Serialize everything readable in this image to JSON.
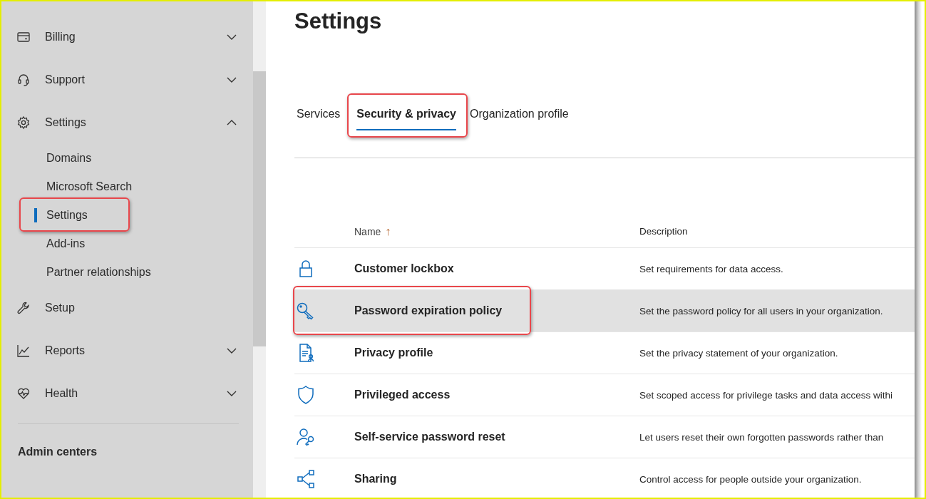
{
  "sidebar": {
    "items": [
      {
        "label": "Billing",
        "expanded": false
      },
      {
        "label": "Support",
        "expanded": false
      },
      {
        "label": "Settings",
        "expanded": true,
        "children": [
          {
            "label": "Domains",
            "selected": false,
            "annotated": false
          },
          {
            "label": "Microsoft Search",
            "selected": false,
            "annotated": false
          },
          {
            "label": "Settings",
            "selected": true,
            "annotated": true
          },
          {
            "label": "Add-ins",
            "selected": false,
            "annotated": false
          },
          {
            "label": "Partner relationships",
            "selected": false,
            "annotated": false
          }
        ]
      },
      {
        "label": "Setup"
      },
      {
        "label": "Reports",
        "expanded": false
      },
      {
        "label": "Health",
        "expanded": false
      }
    ],
    "section_heading": "Admin centers"
  },
  "page": {
    "title": "Settings",
    "tabs": [
      {
        "label": "Services",
        "selected": false,
        "annotated": false
      },
      {
        "label": "Security & privacy",
        "selected": true,
        "annotated": true
      },
      {
        "label": "Organization profile",
        "selected": false,
        "annotated": false
      }
    ],
    "table": {
      "columns": [
        {
          "label": "Name",
          "sort_arrow": "↑"
        },
        {
          "label": "Description"
        }
      ],
      "rows": [
        {
          "name": "Customer lockbox",
          "description": "Set requirements for data access.",
          "selected": false,
          "annotated": false
        },
        {
          "name": "Password expiration policy",
          "description": "Set the password policy for all users in your organization.",
          "selected": true,
          "annotated": true
        },
        {
          "name": "Privacy profile",
          "description": "Set the privacy statement of your organization.",
          "selected": false,
          "annotated": false
        },
        {
          "name": "Privileged access",
          "description": "Set scoped access for privilege tasks and data access withi",
          "selected": false,
          "annotated": false
        },
        {
          "name": "Self-service password reset",
          "description": "Let users reset their own forgotten passwords rather than",
          "selected": false,
          "annotated": false
        },
        {
          "name": "Sharing",
          "description": "Control access for people outside your organization.",
          "selected": false,
          "annotated": false
        }
      ]
    }
  }
}
